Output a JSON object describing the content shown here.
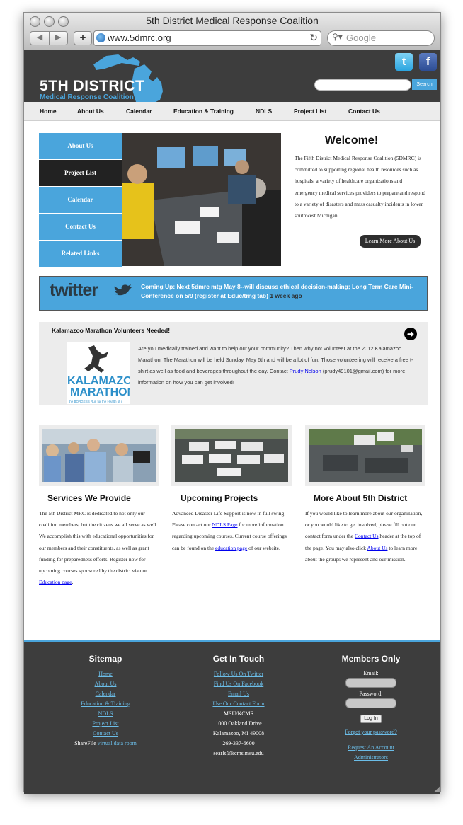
{
  "browser": {
    "window_title": "5th District Medical Response Coalition",
    "url": "www.5dmrc.org",
    "search_placeholder": "Google",
    "back": "◀",
    "forward": "▶",
    "add": "+",
    "reload": "↻"
  },
  "header": {
    "logo_big": "5TH DISTRICT",
    "logo_small": "Medical Response Coalition",
    "twitter_icon": "twitter-icon",
    "facebook_icon": "facebook-icon",
    "search_button": "Search"
  },
  "nav": [
    "Home",
    "About Us",
    "Calendar",
    "Education & Training",
    "NDLS",
    "Project List",
    "Contact Us"
  ],
  "side_menu": [
    {
      "label": "About Us",
      "active": false
    },
    {
      "label": "Project List",
      "active": true
    },
    {
      "label": "Calendar",
      "active": false
    },
    {
      "label": "Contact Us",
      "active": false
    },
    {
      "label": "Related Links",
      "active": false
    }
  ],
  "welcome": {
    "title": "Welcome!",
    "text": "The Fifth District Medical Response Coalition (5DMRC) is committed to supporting regional health resources such as hospitals, a variety of healthcare organizations and emergency medical services providers to prepare and respond to a variety of disasters and mass casualty incidents in lower southwest Michigan.",
    "button": "Learn More About Us"
  },
  "twitter": {
    "logo": "twitter",
    "text": "Coming Up: Next 5dmrc mtg May 8--will discuss ethical decision-making; Long Term Care Mini-Conference on 5/9 (register at Educ/trng tab)",
    "time": "1 week ago"
  },
  "news": {
    "title": "Kalamazoo Marathon Volunteers Needed!",
    "image_text_1": "KALAMAZOO",
    "image_text_2": "MARATHON",
    "image_text_3": "the BORGESS Run for the Health of it",
    "text_before": "Are you medically trained and want to help out your community? Then why not volunteer at the 2012 Kalamazoo Marathon! The Marathon will be held Sunday, May 6th and will be a lot of fun. Those volunteering will receive a free t-shirt as well as food and beverages throughout the day. Contact ",
    "link": "Prudy Nelson",
    "text_after": " (prudy49101@gmail.com) for more information on how you can get involved!",
    "arrow": "➜"
  },
  "columns": [
    {
      "title": "Services We Provide",
      "text": "The 5th District MRC is dedicated to not only our coalition members, but the citizens we all serve as well. We accomplish this with educational opportunities for our members and their constituents, as well as grant funding for preparedness efforts. Register now for upcoming courses sponsored by the district via our ",
      "link": "Education page",
      "text_after": "."
    },
    {
      "title": "Upcoming Projects",
      "text": "Advanced Disaster Life Support is now in full swing! Please contact our ",
      "link": "NDLS Page",
      "text_mid": " for more information regarding upcoming courses. Current course offerings can be found on the ",
      "link2": "education page",
      "text_after": " of our website."
    },
    {
      "title": "More About 5th District",
      "text": "If you would like to learn more about our organization, or you would like to get involved, please fill out our contact form under the ",
      "link": "Contact Us",
      "text_mid": " header at the top of the page. You may also click ",
      "link2": "About Us",
      "text_after": " to learn more about the groups we represent and our mission."
    }
  ],
  "footer": {
    "sitemap_title": "Sitemap",
    "sitemap": [
      "Home",
      "About Us",
      "Calendar",
      "Education & Training",
      "NDLS",
      "Project List",
      "Contact Us"
    ],
    "sharefile_prefix": "ShareFile ",
    "sharefile_link": "virtual data room",
    "touch_title": "Get In Touch",
    "touch_links": [
      "Follow Us On Twitter",
      "Find Us On Facebook",
      "Email Us",
      "Use Our Contact Form"
    ],
    "address": [
      "MSU/KCMS",
      "1000 Oakland Drive",
      "Kalamazoo, MI 49008",
      "269-337-6600",
      "searls@kcms.msu.edu"
    ],
    "members_title": "Members Only",
    "email_label": "Email:",
    "password_label": "Password:",
    "login_button": "Log In",
    "forgot": "Forgot your password?",
    "request": "Request An Account",
    "admins": "Administrators"
  }
}
